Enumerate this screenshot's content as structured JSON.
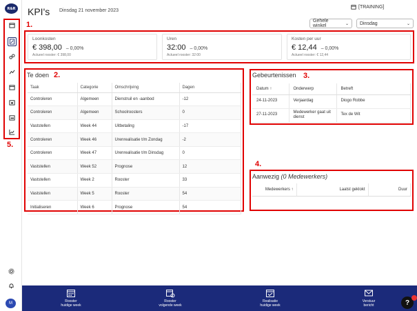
{
  "app": {
    "logo": "R&R",
    "title": "KPI's",
    "date": "Dinsdag 21 november 2023",
    "environment": "[TRAINING]"
  },
  "filters": {
    "store": "Gehele winkel",
    "period": "Dinsdag"
  },
  "annotations": {
    "kpi": "1.",
    "todo": "2.",
    "events": "3.",
    "presence": "4.",
    "nav": "5."
  },
  "kpis": [
    {
      "label": "Loonkosten",
      "value": "€ 398,00",
      "delta": "– 0,00%",
      "sub": "Actueel rooster: € 398,00"
    },
    {
      "label": "Uren",
      "value": "32:00",
      "delta": "– 0,00%",
      "sub": "Actueel rooster: 32:00"
    },
    {
      "label": "Kosten per uur",
      "value": "€ 12,44",
      "delta": "– 0,00%",
      "sub": "Actueel rooster: € 12,44"
    }
  ],
  "todo": {
    "title": "Te doen",
    "columns": [
      "Taak",
      "Categorie",
      "Omschrijving",
      "Dagen"
    ],
    "rows": [
      [
        "Controleren",
        "Algemeen",
        "Dienstruil en -aanbod",
        "-12"
      ],
      [
        "Controleren",
        "Algemeen",
        "Schoolroosters",
        "0"
      ],
      [
        "Vaststellen",
        "Week 44",
        "Uitbetaling",
        "-17"
      ],
      [
        "Controleren",
        "Week 46",
        "Urenrealisatie t/m Zondag",
        "-2"
      ],
      [
        "Controleren",
        "Week 47",
        "Urenrealisatie t/m Dinsdag",
        "0"
      ],
      [
        "Vaststellen",
        "Week 52",
        "Prognose",
        "12"
      ],
      [
        "Vaststellen",
        "Week 2",
        "Rooster",
        "33"
      ],
      [
        "Vaststellen",
        "Week 5",
        "Rooster",
        "54"
      ],
      [
        "Initialiseren",
        "Week 6",
        "Prognose",
        "54"
      ]
    ]
  },
  "events": {
    "title": "Gebeurtenissen",
    "columns": [
      "Datum",
      "Onderwerp",
      "Betreft"
    ],
    "rows": [
      [
        "24-11-2023",
        "Verjaardag",
        "Diogo Robbe"
      ],
      [
        "27-11-2023",
        "Medewerker gaat uit dienst",
        "Tex de Wit"
      ]
    ]
  },
  "presence": {
    "title": "Aanwezig",
    "count_label": "(0 Medewerkers)",
    "columns": [
      "Medewerkers",
      "Laatst geklokt",
      "Duur"
    ]
  },
  "bottom_nav": [
    {
      "label1": "Rooster",
      "label2": "huidige week",
      "icon": "calendar-grid-icon"
    },
    {
      "label1": "Rooster",
      "label2": "volgende week",
      "icon": "calendar-refresh-icon"
    },
    {
      "label1": "Realisatie",
      "label2": "huidige week",
      "icon": "calendar-check-icon"
    },
    {
      "label1": "Verstuur",
      "label2": "bericht",
      "icon": "envelope-icon"
    }
  ],
  "user": {
    "initial": "M"
  },
  "help": "?"
}
